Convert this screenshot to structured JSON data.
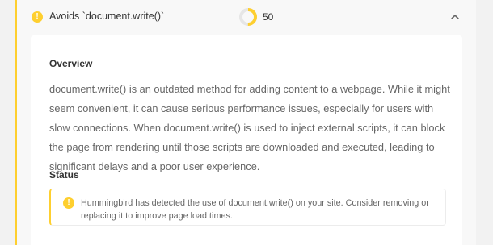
{
  "audit": {
    "title": "Avoids `document.write()`",
    "score": "50",
    "score_fraction": 0.5,
    "status_color": "#fecf2f",
    "icons": {
      "status": "warning-icon",
      "toggle": "chevron-up-icon",
      "score": "score-ring-icon"
    }
  },
  "overview": {
    "title": "Overview",
    "text": "document.write() is an outdated method for adding content to a webpage. While it might seem convenient, it can cause serious performance issues, especially for users with slow connections. When document.write() is used to inject external scripts, it can block the page from rendering until those scripts are downloaded and executed, leading to significant delays and a poor user experience."
  },
  "status": {
    "title": "Status",
    "message": "Hummingbird has detected the use of document.write() on your site. Consider removing or replacing it to improve page load times."
  }
}
